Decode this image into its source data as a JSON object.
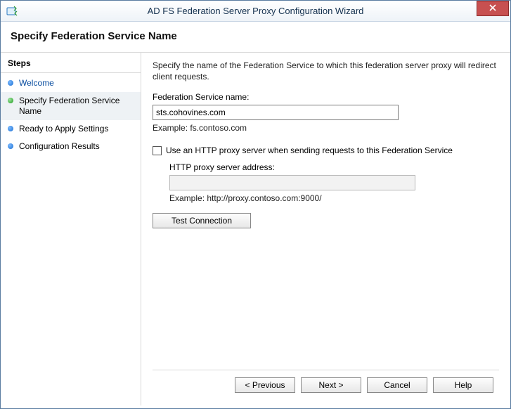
{
  "window": {
    "title": "AD FS Federation Server Proxy Configuration Wizard"
  },
  "header": {
    "title": "Specify Federation Service Name"
  },
  "sidebar": {
    "title": "Steps",
    "items": [
      {
        "label": "Welcome",
        "link": true,
        "bullet": "blue",
        "current": false
      },
      {
        "label": "Specify Federation Service Name",
        "link": false,
        "bullet": "green",
        "current": true
      },
      {
        "label": "Ready to Apply Settings",
        "link": false,
        "bullet": "blue",
        "current": false
      },
      {
        "label": "Configuration Results",
        "link": false,
        "bullet": "blue",
        "current": false
      }
    ]
  },
  "main": {
    "description": "Specify the name of the Federation Service to which this federation server proxy will redirect  client requests.",
    "service_name_label": "Federation Service name:",
    "service_name_value": "sts.cohovines.com",
    "service_name_example": "Example: fs.contoso.com",
    "use_http_proxy_label": "Use an HTTP proxy server when sending requests to this Federation Service",
    "use_http_proxy_checked": false,
    "http_proxy_address_label": "HTTP proxy server address:",
    "http_proxy_address_value": "",
    "http_proxy_example": "Example: http://proxy.contoso.com:9000/",
    "test_connection_label": "Test Connection"
  },
  "footer": {
    "previous": "< Previous",
    "next": "Next >",
    "cancel": "Cancel",
    "help": "Help"
  }
}
